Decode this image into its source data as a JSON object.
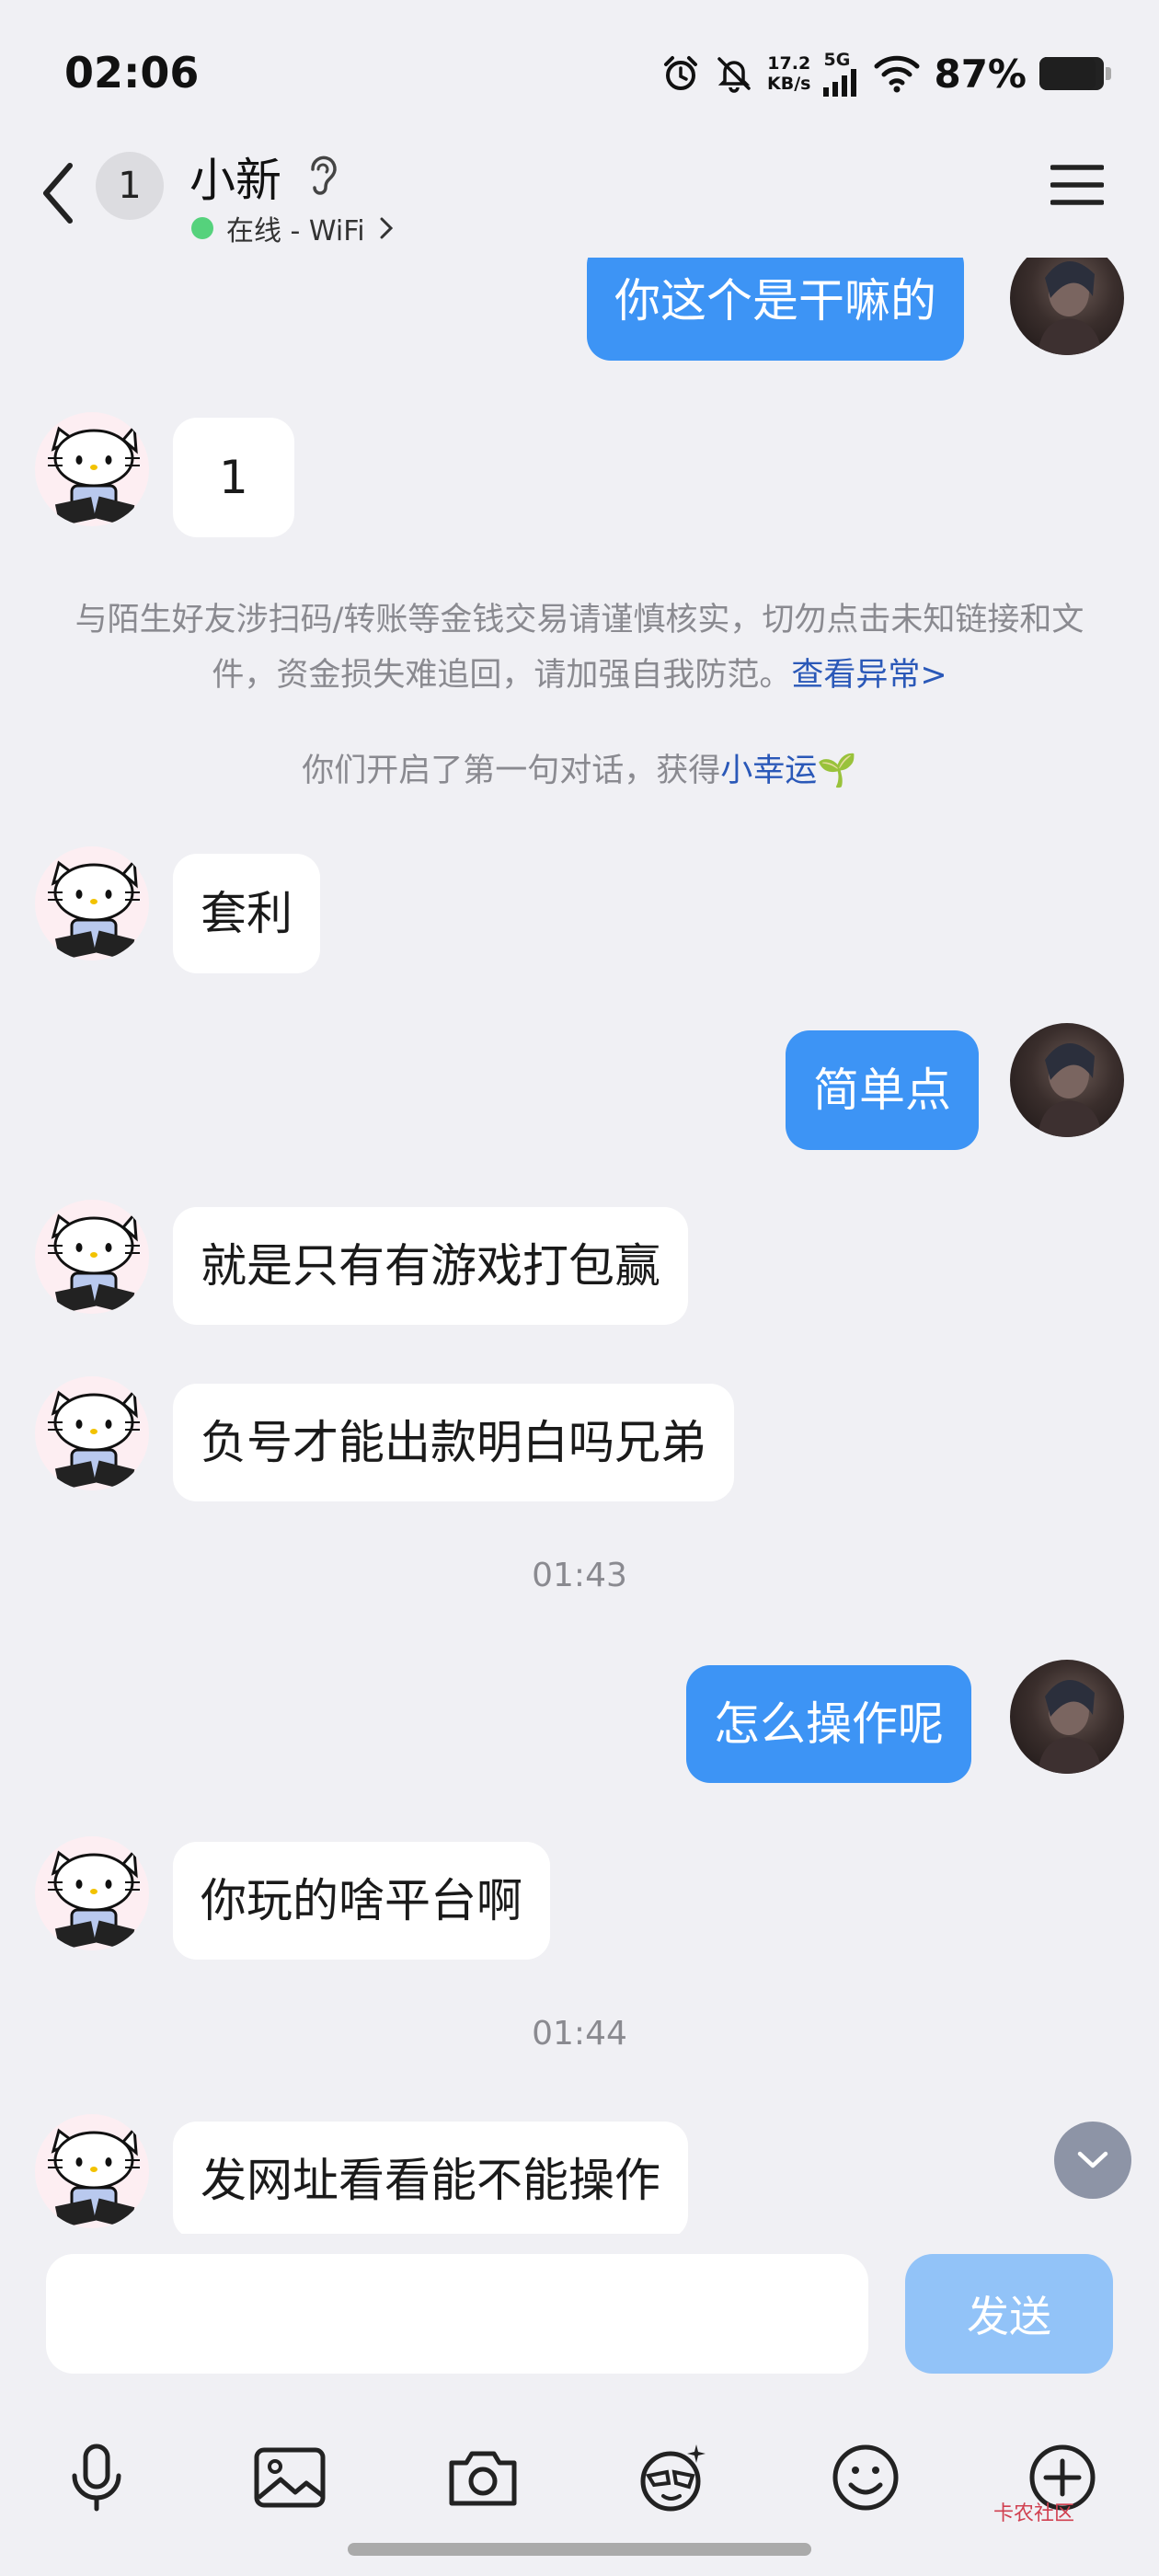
{
  "status_bar": {
    "time": "02:06",
    "net_speed_value": "17.2",
    "net_speed_unit": "KB/s",
    "network": "5G",
    "battery_text": "87%",
    "battery_level": 0.87
  },
  "header": {
    "unread_count": "1",
    "contact_name": "小新",
    "online_status": "在线 - WiFi",
    "status_color": "#55d27c"
  },
  "messages": [
    {
      "side": "out",
      "text": "你这个是干嘛的"
    },
    {
      "side": "in",
      "text": "1"
    },
    {
      "side": "in",
      "text": "套利"
    },
    {
      "side": "out",
      "text": "简单点"
    },
    {
      "side": "in",
      "text": "就是只有有游戏打包赢"
    },
    {
      "side": "in",
      "text": "负号才能出款明白吗兄弟"
    },
    {
      "side": "out",
      "text": "怎么操作呢"
    },
    {
      "side": "in",
      "text": "你玩的啥平台啊"
    },
    {
      "side": "in",
      "text": "发网址看看能不能操作"
    }
  ],
  "safety_notice": {
    "text": "与陌生好友涉扫码/转账等金钱交易请谨慎核实，切勿点击未知链接和文件，资金损失难追回，请加强自我防范。",
    "link": "查看异常>"
  },
  "first_chat_notice": {
    "prefix": "你们开启了第一句对话，获得",
    "highlight": "小幸运",
    "emoji": "🌱"
  },
  "timestamps": [
    "01:43",
    "01:44"
  ],
  "input": {
    "value": "",
    "placeholder": "",
    "send_label": "发送"
  },
  "toolbar_icons": [
    "microphone-icon",
    "image-icon",
    "camera-icon",
    "sticker-icon",
    "emoji-icon",
    "plus-icon"
  ],
  "watermark": "卡农社区",
  "colors": {
    "accent": "#3d94f5",
    "send_disabled": "#92c3f8",
    "background": "#f0f0f4",
    "link": "#2a58b8"
  }
}
